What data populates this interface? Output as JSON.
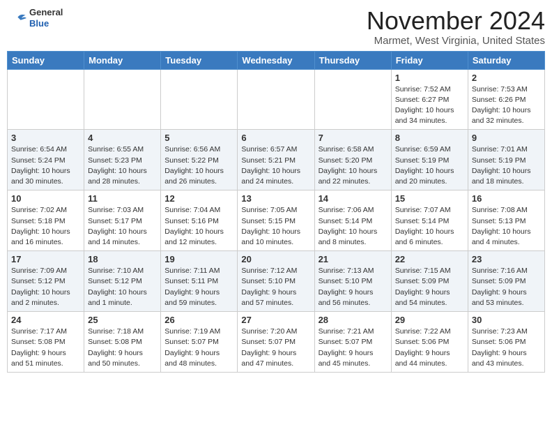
{
  "header": {
    "logo_general": "General",
    "logo_blue": "Blue",
    "month_title": "November 2024",
    "location": "Marmet, West Virginia, United States"
  },
  "weekdays": [
    "Sunday",
    "Monday",
    "Tuesday",
    "Wednesday",
    "Thursday",
    "Friday",
    "Saturday"
  ],
  "weeks": [
    [
      {
        "day": "",
        "info": ""
      },
      {
        "day": "",
        "info": ""
      },
      {
        "day": "",
        "info": ""
      },
      {
        "day": "",
        "info": ""
      },
      {
        "day": "",
        "info": ""
      },
      {
        "day": "1",
        "info": "Sunrise: 7:52 AM\nSunset: 6:27 PM\nDaylight: 10 hours\nand 34 minutes."
      },
      {
        "day": "2",
        "info": "Sunrise: 7:53 AM\nSunset: 6:26 PM\nDaylight: 10 hours\nand 32 minutes."
      }
    ],
    [
      {
        "day": "3",
        "info": "Sunrise: 6:54 AM\nSunset: 5:24 PM\nDaylight: 10 hours\nand 30 minutes."
      },
      {
        "day": "4",
        "info": "Sunrise: 6:55 AM\nSunset: 5:23 PM\nDaylight: 10 hours\nand 28 minutes."
      },
      {
        "day": "5",
        "info": "Sunrise: 6:56 AM\nSunset: 5:22 PM\nDaylight: 10 hours\nand 26 minutes."
      },
      {
        "day": "6",
        "info": "Sunrise: 6:57 AM\nSunset: 5:21 PM\nDaylight: 10 hours\nand 24 minutes."
      },
      {
        "day": "7",
        "info": "Sunrise: 6:58 AM\nSunset: 5:20 PM\nDaylight: 10 hours\nand 22 minutes."
      },
      {
        "day": "8",
        "info": "Sunrise: 6:59 AM\nSunset: 5:19 PM\nDaylight: 10 hours\nand 20 minutes."
      },
      {
        "day": "9",
        "info": "Sunrise: 7:01 AM\nSunset: 5:19 PM\nDaylight: 10 hours\nand 18 minutes."
      }
    ],
    [
      {
        "day": "10",
        "info": "Sunrise: 7:02 AM\nSunset: 5:18 PM\nDaylight: 10 hours\nand 16 minutes."
      },
      {
        "day": "11",
        "info": "Sunrise: 7:03 AM\nSunset: 5:17 PM\nDaylight: 10 hours\nand 14 minutes."
      },
      {
        "day": "12",
        "info": "Sunrise: 7:04 AM\nSunset: 5:16 PM\nDaylight: 10 hours\nand 12 minutes."
      },
      {
        "day": "13",
        "info": "Sunrise: 7:05 AM\nSunset: 5:15 PM\nDaylight: 10 hours\nand 10 minutes."
      },
      {
        "day": "14",
        "info": "Sunrise: 7:06 AM\nSunset: 5:14 PM\nDaylight: 10 hours\nand 8 minutes."
      },
      {
        "day": "15",
        "info": "Sunrise: 7:07 AM\nSunset: 5:14 PM\nDaylight: 10 hours\nand 6 minutes."
      },
      {
        "day": "16",
        "info": "Sunrise: 7:08 AM\nSunset: 5:13 PM\nDaylight: 10 hours\nand 4 minutes."
      }
    ],
    [
      {
        "day": "17",
        "info": "Sunrise: 7:09 AM\nSunset: 5:12 PM\nDaylight: 10 hours\nand 2 minutes."
      },
      {
        "day": "18",
        "info": "Sunrise: 7:10 AM\nSunset: 5:12 PM\nDaylight: 10 hours\nand 1 minute."
      },
      {
        "day": "19",
        "info": "Sunrise: 7:11 AM\nSunset: 5:11 PM\nDaylight: 9 hours\nand 59 minutes."
      },
      {
        "day": "20",
        "info": "Sunrise: 7:12 AM\nSunset: 5:10 PM\nDaylight: 9 hours\nand 57 minutes."
      },
      {
        "day": "21",
        "info": "Sunrise: 7:13 AM\nSunset: 5:10 PM\nDaylight: 9 hours\nand 56 minutes."
      },
      {
        "day": "22",
        "info": "Sunrise: 7:15 AM\nSunset: 5:09 PM\nDaylight: 9 hours\nand 54 minutes."
      },
      {
        "day": "23",
        "info": "Sunrise: 7:16 AM\nSunset: 5:09 PM\nDaylight: 9 hours\nand 53 minutes."
      }
    ],
    [
      {
        "day": "24",
        "info": "Sunrise: 7:17 AM\nSunset: 5:08 PM\nDaylight: 9 hours\nand 51 minutes."
      },
      {
        "day": "25",
        "info": "Sunrise: 7:18 AM\nSunset: 5:08 PM\nDaylight: 9 hours\nand 50 minutes."
      },
      {
        "day": "26",
        "info": "Sunrise: 7:19 AM\nSunset: 5:07 PM\nDaylight: 9 hours\nand 48 minutes."
      },
      {
        "day": "27",
        "info": "Sunrise: 7:20 AM\nSunset: 5:07 PM\nDaylight: 9 hours\nand 47 minutes."
      },
      {
        "day": "28",
        "info": "Sunrise: 7:21 AM\nSunset: 5:07 PM\nDaylight: 9 hours\nand 45 minutes."
      },
      {
        "day": "29",
        "info": "Sunrise: 7:22 AM\nSunset: 5:06 PM\nDaylight: 9 hours\nand 44 minutes."
      },
      {
        "day": "30",
        "info": "Sunrise: 7:23 AM\nSunset: 5:06 PM\nDaylight: 9 hours\nand 43 minutes."
      }
    ]
  ]
}
